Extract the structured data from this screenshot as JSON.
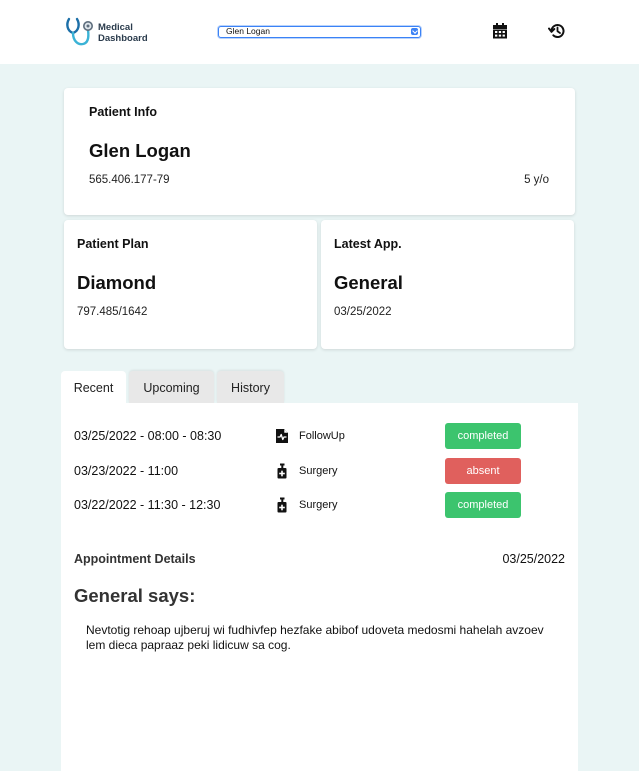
{
  "header": {
    "app_name_line1": "Medical",
    "app_name_line2": "Dashboard",
    "patient_select": {
      "selected": "Glen Logan"
    },
    "calendar_icon": "calendar-icon",
    "history_icon": "history-icon"
  },
  "patient_info": {
    "label": "Patient Info",
    "name": "Glen Logan",
    "id_number": "565.406.177-79",
    "age": "5 y/o"
  },
  "patient_plan": {
    "label": "Patient Plan",
    "plan": "Diamond",
    "plan_number": "797.485/1642"
  },
  "latest_app": {
    "label": "Latest App.",
    "type": "General",
    "date": "03/25/2022"
  },
  "tabs": [
    {
      "label": "Recent",
      "active": true
    },
    {
      "label": "Upcoming",
      "active": false
    },
    {
      "label": "History",
      "active": false
    }
  ],
  "appointments": [
    {
      "time": "03/25/2022 - 08:00 - 08:30",
      "type": "FollowUp",
      "icon": "medical-report-icon",
      "status": "completed",
      "status_color": "#3cc46e"
    },
    {
      "time": "03/23/2022 - 11:00",
      "type": "Surgery",
      "icon": "hand-sanitizer-icon",
      "status": "absent",
      "status_color": "#e0605d"
    },
    {
      "time": "03/22/2022 - 11:30 - 12:30",
      "type": "Surgery",
      "icon": "hand-sanitizer-icon",
      "status": "completed",
      "status_color": "#3cc46e"
    }
  ],
  "details": {
    "label": "Appointment Details",
    "date": "03/25/2022",
    "doctor_says": "General says:",
    "note": "Nevtotig rehoap ujberuj wi fudhivfep hezfake abibof udoveta medosmi hahelah avzoev lem dieca papraaz peki lidicuw sa cog."
  },
  "colors": {
    "background": "#eaf5f5",
    "accent": "#3b82f6",
    "completed": "#3cc46e",
    "absent": "#e0605d"
  }
}
